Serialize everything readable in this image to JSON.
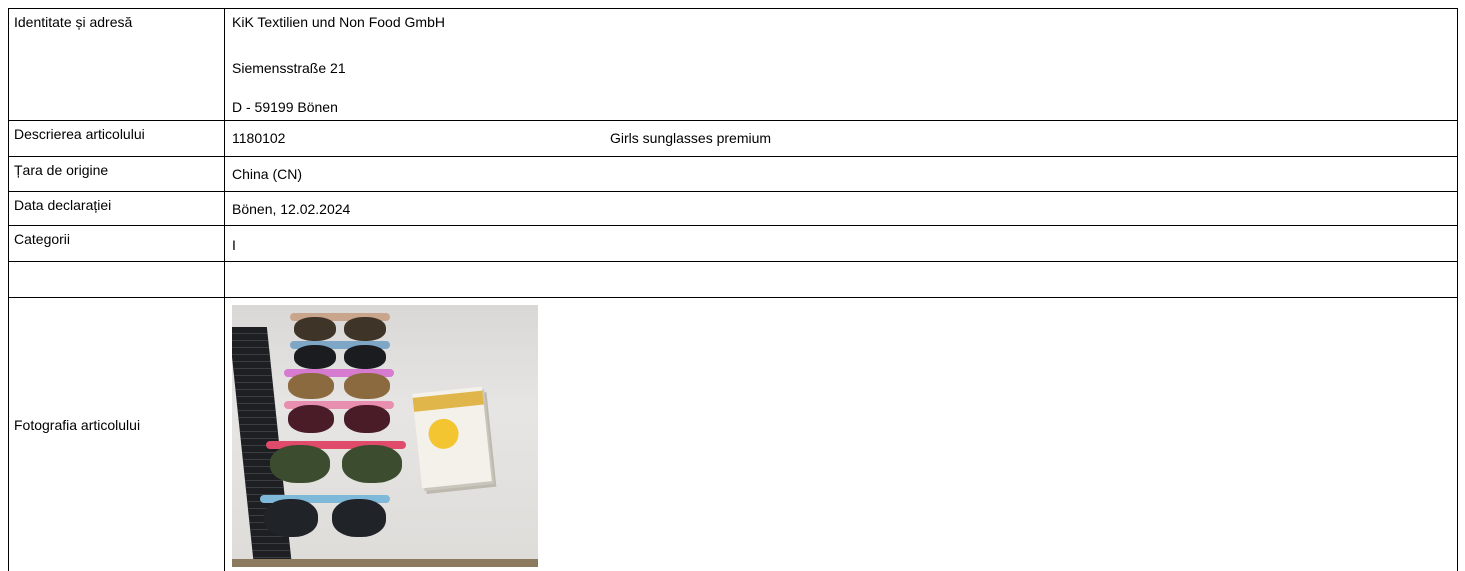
{
  "rows": {
    "identity": {
      "label": "Identitate și adresă",
      "lines": [
        "KiK Textilien und Non Food GmbH",
        "Siemensstraße 21",
        "D - 59199 Bönen"
      ]
    },
    "description": {
      "label": "Descrierea articolului",
      "article_number": "1180102",
      "article_name": "Girls sunglasses premium"
    },
    "origin": {
      "label": "Țara de origine",
      "value": "China (CN)"
    },
    "declaration_date": {
      "label": "Data declarației",
      "value": "Bönen, 12.02.2024"
    },
    "category": {
      "label": "Categorii",
      "value": "I"
    },
    "photo": {
      "label": "Fotografia articolului"
    }
  },
  "colors": {
    "border": "#000000",
    "background": "#ffffff"
  }
}
